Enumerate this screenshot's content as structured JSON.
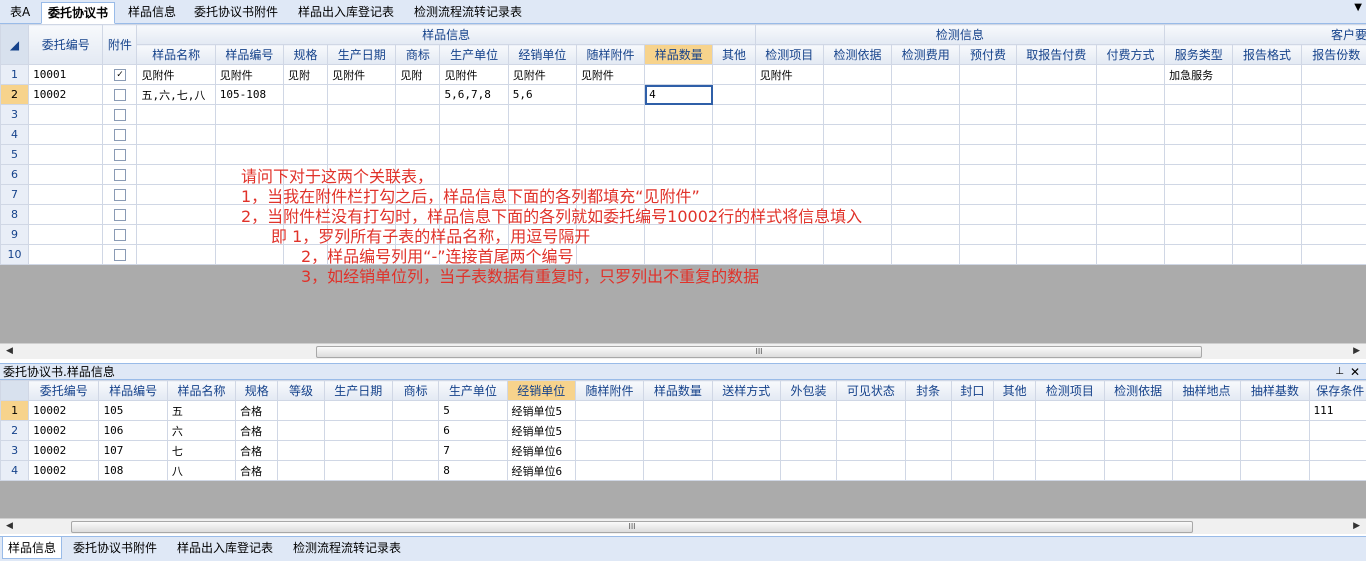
{
  "top_tabs": [
    "表A",
    "委托协议书",
    "样品信息",
    "委托协议书附件",
    "样品出入库登记表",
    "检测流程流转记录表"
  ],
  "top_active": "委托协议书",
  "upper": {
    "groups": {
      "sample": "样品信息",
      "inspect": "检测信息",
      "customer": "客户要"
    },
    "fixed_headers": [
      "委托编号",
      "附件"
    ],
    "sample_cols": [
      "样品名称",
      "样品编号",
      "规格",
      "生产日期",
      "商标",
      "生产单位",
      "经销单位",
      "随样附件",
      "样品数量",
      "其他"
    ],
    "inspect_cols": [
      "检测项目",
      "检测依据",
      "检测费用",
      "预付费",
      "取报告付费",
      "付费方式"
    ],
    "customer_cols": [
      "服务类型",
      "报告格式",
      "报告份数"
    ],
    "row_numbers": [
      "1",
      "2",
      "3",
      "4",
      "5",
      "6",
      "7",
      "8",
      "9",
      "10"
    ],
    "rows": [
      {
        "id": "10001",
        "attach": true,
        "sample": [
          "见附件",
          "见附件",
          "见附",
          "见附件",
          "见附",
          "见附件",
          "见附件",
          "见附件",
          "",
          ""
        ],
        "inspect": [
          "见附件",
          "",
          "",
          "",
          "",
          ""
        ],
        "customer": [
          "加急服务",
          "",
          ""
        ]
      },
      {
        "id": "10002",
        "attach": false,
        "sample": [
          "五,六,七,八",
          "105-108",
          "",
          "",
          "",
          "5,6,7,8",
          "5,6",
          "",
          "4",
          ""
        ],
        "inspect": [
          "",
          "",
          "",
          "",
          "",
          ""
        ],
        "customer": [
          "",
          "",
          ""
        ]
      }
    ]
  },
  "annotation": [
    "请问下对于这两个关联表，",
    "1，当我在附件栏打勾之后，样品信息下面的各列都填充“见附件”",
    "2，当附件栏没有打勾时，样品信息下面的各列就如委托编号10002行的样式将信息填入",
    "即 1，罗列所有子表的样品名称，用逗号隔开",
    "2，样品编号列用“-”连接首尾两个编号",
    "3，如经销单位列，当子表数据有重复时，只罗列出不重复的数据"
  ],
  "panel_title": "委托协议书.样品信息",
  "lower": {
    "headers": [
      "委托编号",
      "样品编号",
      "样品名称",
      "规格",
      "等级",
      "生产日期",
      "商标",
      "生产单位",
      "经销单位",
      "随样附件",
      "样品数量",
      "送样方式",
      "外包装",
      "可见状态",
      "封条",
      "封口",
      "其他",
      "检测项目",
      "检测依据",
      "抽样地点",
      "抽样基数",
      "保存条件"
    ],
    "row_numbers": [
      "1",
      "2",
      "3",
      "4"
    ],
    "rows": [
      [
        "10002",
        "105",
        "五",
        "合格",
        "",
        "",
        "",
        "5",
        "经销单位5",
        "",
        "",
        "",
        "",
        "",
        "",
        "",
        "",
        "",
        "",
        "",
        "",
        "111"
      ],
      [
        "10002",
        "106",
        "六",
        "合格",
        "",
        "",
        "",
        "6",
        "经销单位5",
        "",
        "",
        "",
        "",
        "",
        "",
        "",
        "",
        "",
        "",
        "",
        "",
        ""
      ],
      [
        "10002",
        "107",
        "七",
        "合格",
        "",
        "",
        "",
        "7",
        "经销单位6",
        "",
        "",
        "",
        "",
        "",
        "",
        "",
        "",
        "",
        "",
        "",
        "",
        ""
      ],
      [
        "10002",
        "108",
        "八",
        "合格",
        "",
        "",
        "",
        "8",
        "经销单位6",
        "",
        "",
        "",
        "",
        "",
        "",
        "",
        "",
        "",
        "",
        "",
        "",
        ""
      ]
    ]
  },
  "bottom_tabs": [
    "样品信息",
    "委托协议书附件",
    "样品出入库登记表",
    "检测流程流转记录表"
  ],
  "bottom_active": "样品信息",
  "scroll_grip": "III"
}
